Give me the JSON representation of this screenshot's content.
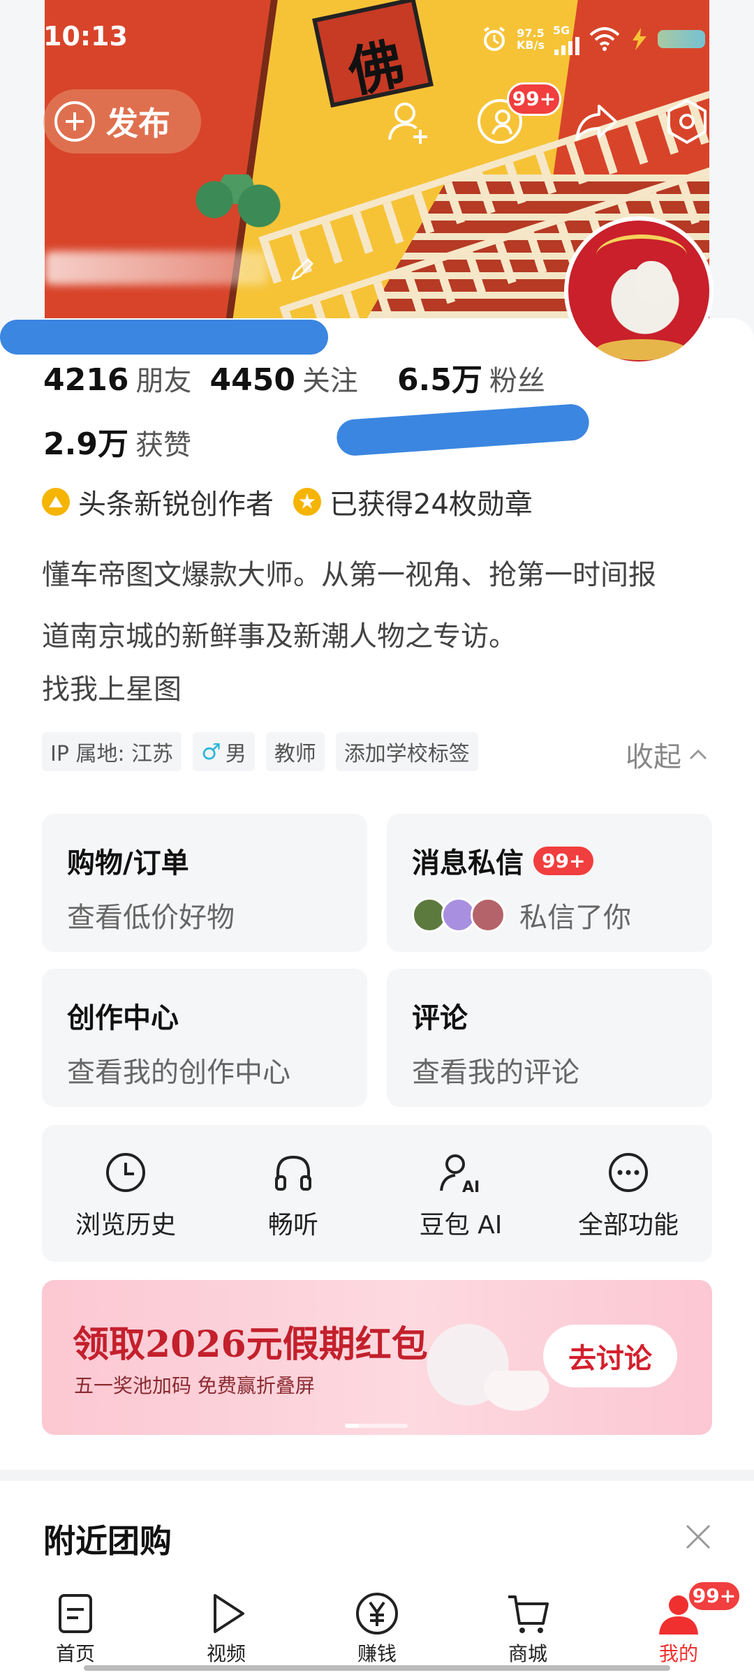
{
  "status_bar": {
    "time": "10:13",
    "speed_value": "97.5",
    "speed_unit": "KB/s",
    "network": "5G"
  },
  "header": {
    "publish_label": "发布",
    "notification_badge": "99+"
  },
  "stats": {
    "friends_count": "4216",
    "friends_label": "朋友",
    "following_count": "4450",
    "following_label": "关注",
    "fans_count": "6.5万",
    "fans_label": "粉丝",
    "likes_count": "2.9万",
    "likes_label": "获赞"
  },
  "badges": {
    "creator_title": "头条新锐创作者",
    "medals": "已获得24枚勋章"
  },
  "bio": {
    "line1": "懂车帝图文爆款大师。从第一视角、抢第一时间报",
    "line2": "道南京城的新鲜事及新潮人物之专访。",
    "line3": "找我上星图"
  },
  "tags": {
    "ip": "IP 属地: 江苏",
    "gender": "男",
    "job": "教师",
    "school": "添加学校标签",
    "collapse_label": "收起"
  },
  "entries": {
    "shopping_title": "购物/订单",
    "shopping_sub": "查看低价好物",
    "messages_title": "消息私信",
    "messages_badge": "99+",
    "messages_sub": "私信了你",
    "creation_title": "创作中心",
    "creation_sub": "查看我的创作中心",
    "comments_title": "评论",
    "comments_sub": "查看我的评论"
  },
  "features": [
    {
      "label": "浏览历史",
      "icon": "clock-icon"
    },
    {
      "label": "畅听",
      "icon": "headphones-icon"
    },
    {
      "label": "豆包 AI",
      "icon": "ai-person-icon"
    },
    {
      "label": "全部功能",
      "icon": "more-icon"
    }
  ],
  "promo": {
    "title": "领取2026元假期红包",
    "subtitle": "五一奖池加码 免费赢折叠屏",
    "button": "去讨论"
  },
  "nearby": {
    "title": "附近团购"
  },
  "bottom_nav": {
    "home": "首页",
    "video": "视频",
    "earn": "赚钱",
    "mall": "商城",
    "mine": "我的",
    "mine_badge": "99+"
  },
  "colors": {
    "accent_red": "#f13e3e",
    "promo_red": "#c3202c",
    "badge_gold": "#f5b400"
  }
}
